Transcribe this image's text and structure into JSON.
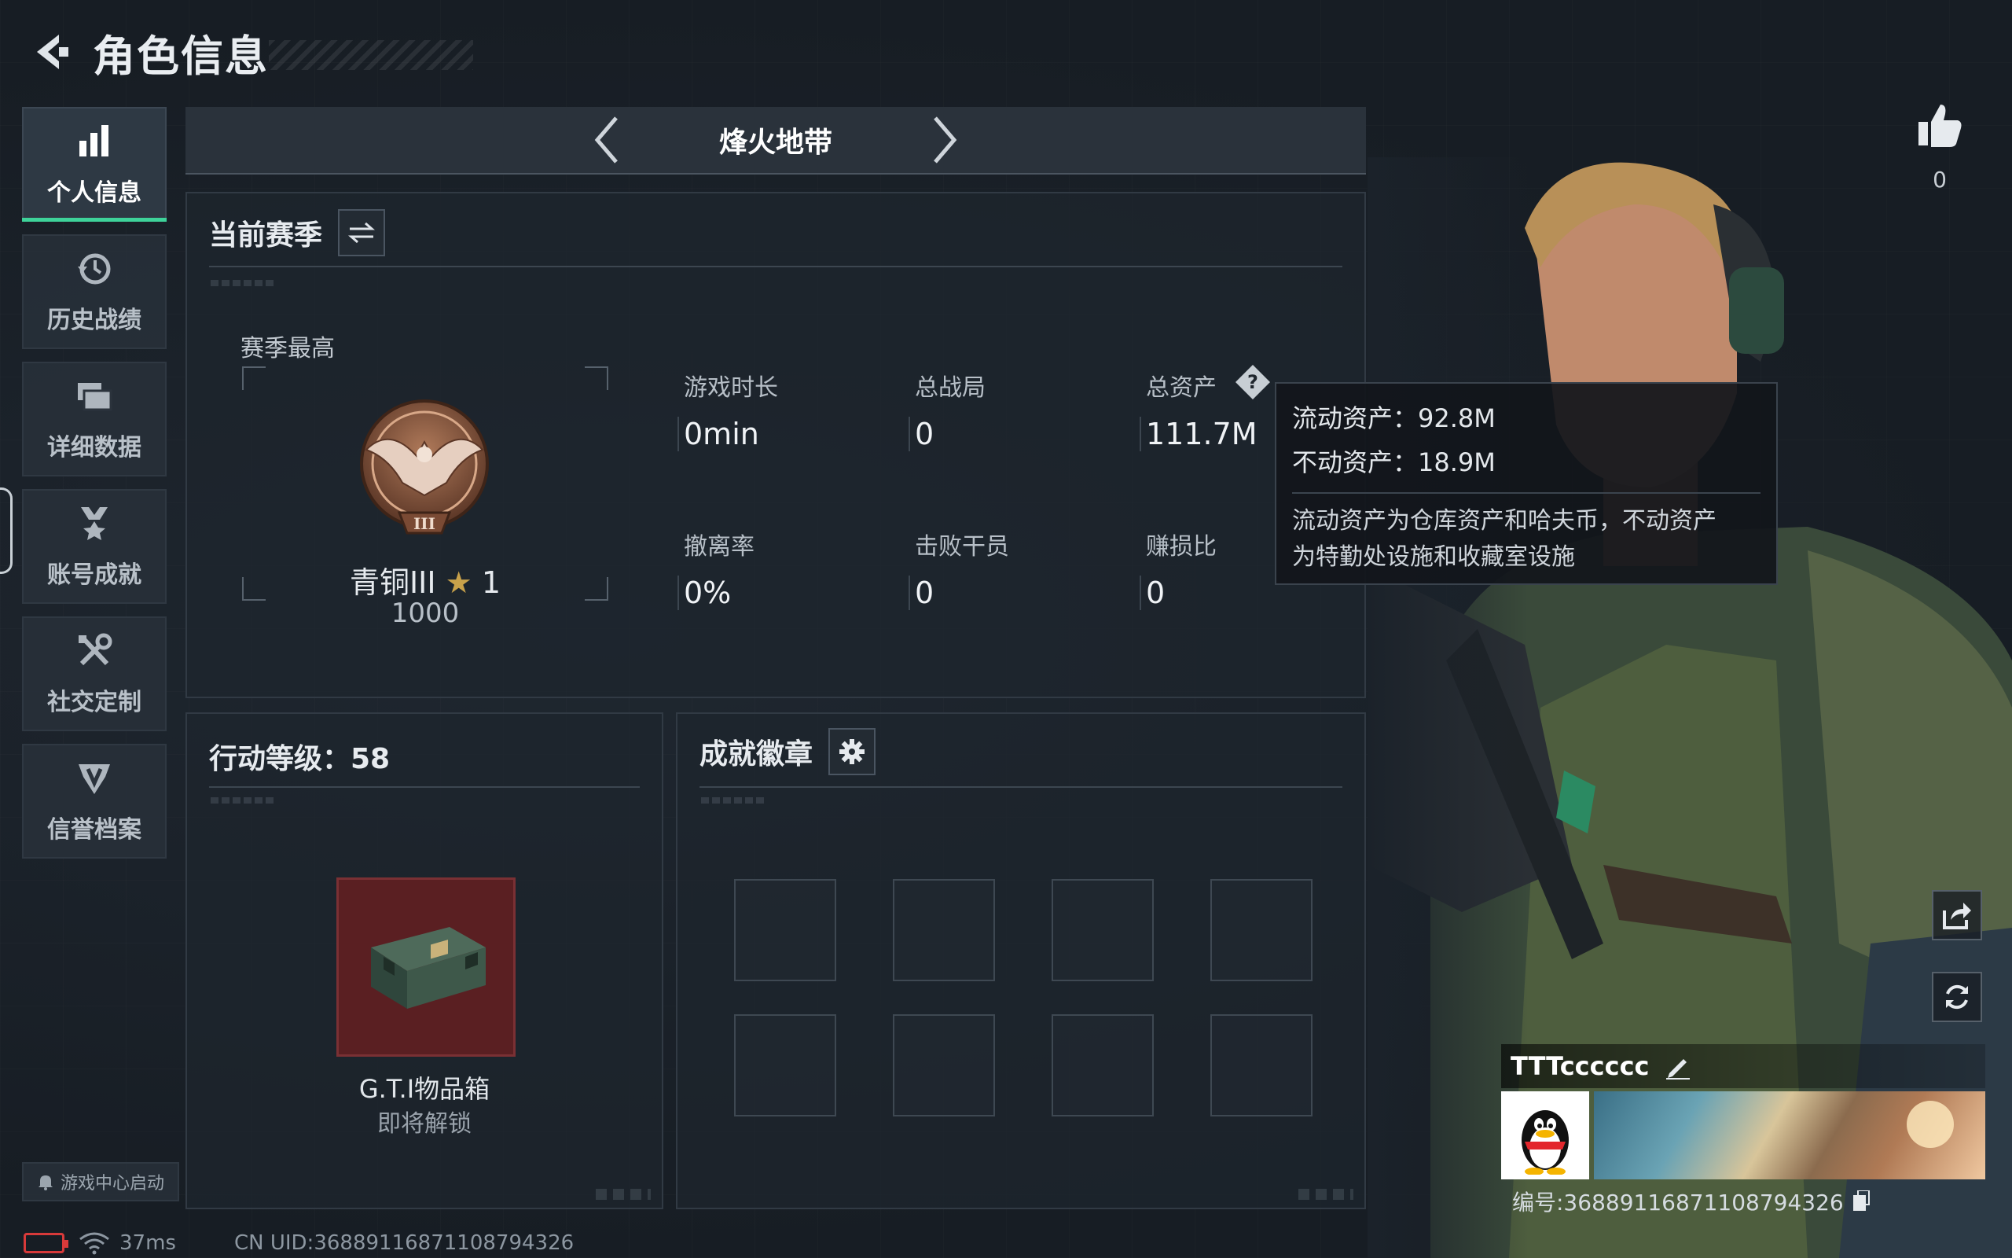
{
  "header": {
    "title": "角色信息"
  },
  "sidebar": {
    "items": [
      {
        "label": "个人信息",
        "icon": "bar-chart-icon",
        "active": true
      },
      {
        "label": "历史战绩",
        "icon": "history-clock-icon",
        "active": false
      },
      {
        "label": "详细数据",
        "icon": "folder-icon",
        "active": false
      },
      {
        "label": "账号成就",
        "icon": "medal-icon",
        "active": false
      },
      {
        "label": "社交定制",
        "icon": "tools-icon",
        "active": false
      },
      {
        "label": "信誉档案",
        "icon": "shield-emblem-icon",
        "active": false
      }
    ],
    "game_center": "游戏中心启动"
  },
  "mode": {
    "name": "烽火地带"
  },
  "season": {
    "title": "当前赛季",
    "best_label": "赛季最高",
    "rank_name": "青铜III",
    "rank_stars": "1",
    "rank_points": "1000",
    "stats": [
      {
        "label": "游戏时长",
        "value": "0min"
      },
      {
        "label": "总战局",
        "value": "0"
      },
      {
        "label": "总资产",
        "value": "111.7M"
      },
      {
        "label": "撤离率",
        "value": "0%"
      },
      {
        "label": "击败干员",
        "value": "0"
      },
      {
        "label": "赚损比",
        "value": "0"
      }
    ]
  },
  "tooltip": {
    "liquid": "流动资产：92.8M",
    "fixed": "不动资产：18.9M",
    "desc_line1": "流动资产为仓库资产和哈夫币，不动资产",
    "desc_line2": "为特勤处设施和收藏室设施"
  },
  "level": {
    "title": "行动等级：58",
    "reward_name": "G.T.I物品箱",
    "reward_status": "即将解锁"
  },
  "badges": {
    "title": "成就徽章",
    "slot_count": 8
  },
  "profile": {
    "likes": "0",
    "name": "TTTcccccc",
    "uid_text": "编号:3688911687110879432​6"
  },
  "status": {
    "ping": "37ms",
    "cn_uid": "CN UID:36889116871108794326"
  },
  "colors": {
    "accent": "#3ed39a",
    "reward_bg": "#5a1f22",
    "battery": "#d83a3a"
  }
}
